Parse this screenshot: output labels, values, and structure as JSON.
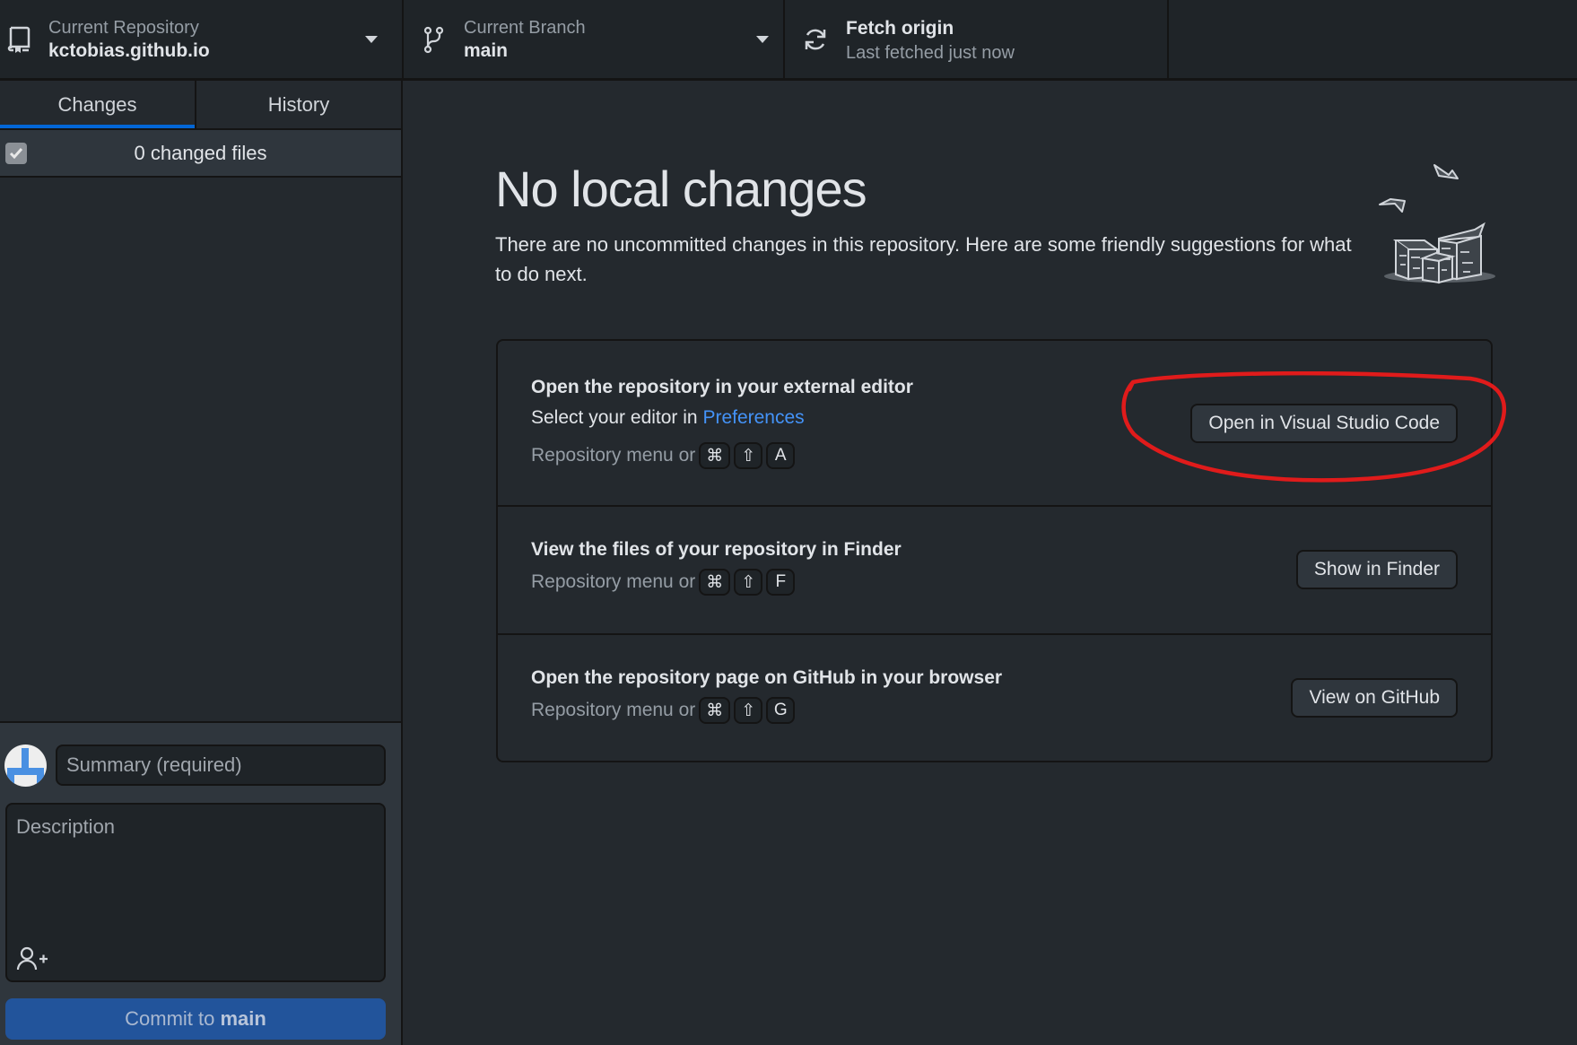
{
  "toolbar": {
    "repository": {
      "label": "Current Repository",
      "value": "kctobias.github.io",
      "icon": "repo-icon"
    },
    "branch": {
      "label": "Current Branch",
      "value": "main",
      "icon": "git-branch-icon"
    },
    "fetch": {
      "title": "Fetch origin",
      "subtitle": "Last fetched just now",
      "icon": "sync-icon"
    }
  },
  "sidebar": {
    "tabs": [
      {
        "label": "Changes",
        "active": true
      },
      {
        "label": "History",
        "active": false
      }
    ],
    "changed_files": {
      "label": "0 changed files",
      "checked": true
    },
    "commit": {
      "summary_placeholder": "Summary (required)",
      "summary_value": "",
      "description_placeholder": "Description",
      "description_value": "",
      "button_prefix": "Commit to ",
      "button_branch": "main"
    }
  },
  "main": {
    "title": "No local changes",
    "subtitle": "There are no uncommitted changes in this repository. Here are some friendly suggestions for what to do next.",
    "suggestions": [
      {
        "title": "Open the repository in your external editor",
        "sub_prefix": "Select your editor in ",
        "sub_link": "Preferences",
        "hint": "Repository menu or",
        "keys": [
          "⌘",
          "⇧",
          "A"
        ],
        "button": "Open in Visual Studio Code"
      },
      {
        "title": "View the files of your repository in Finder",
        "hint": "Repository menu or",
        "keys": [
          "⌘",
          "⇧",
          "F"
        ],
        "button": "Show in Finder"
      },
      {
        "title": "Open the repository page on GitHub in your browser",
        "hint": "Repository menu or",
        "keys": [
          "⌘",
          "⇧",
          "G"
        ],
        "button": "View on GitHub"
      }
    ]
  },
  "colors": {
    "accent": "#0366d6",
    "link": "#4493f8",
    "commit_button": "#22549b",
    "annotation": "#e01b1b"
  }
}
